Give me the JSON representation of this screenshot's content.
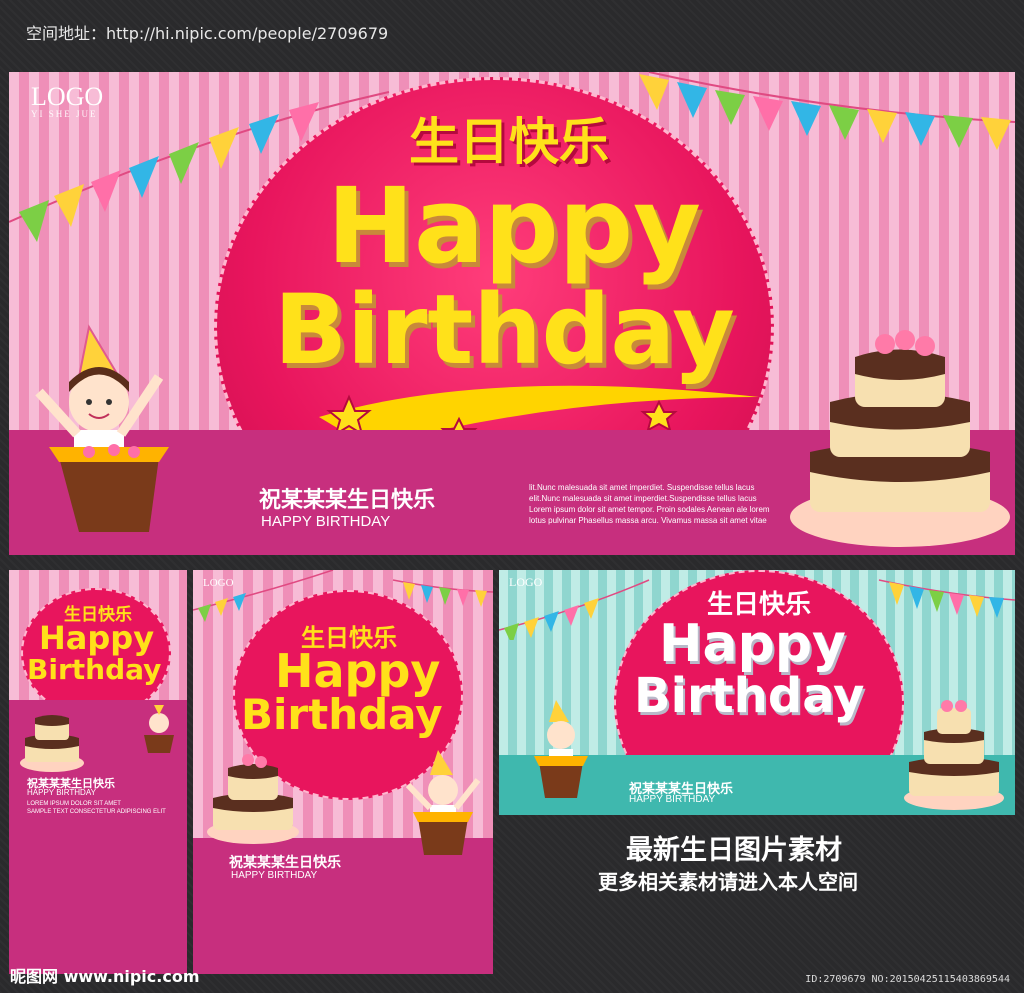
{
  "header": {
    "url_label": "空间地址：",
    "url": "http://hi.nipic.com/people/2709679"
  },
  "main_banner": {
    "logo": "LOGO",
    "logo_sub": "YI SHE JUE",
    "title_cn": "生日快乐",
    "title_en_1": "Happy",
    "title_en_2": "Birthday",
    "caption_cn": "祝某某某生日快乐",
    "caption_en": "HAPPY BIRTHDAY",
    "body_lines": [
      "lit.Nunc malesuada sit amet imperdiet. Suspendisse tellus lacus",
      "elit.Nunc malesuada sit amet imperdiet.Suspendisse tellus lacus",
      "Lorem ipsum dolor sit amet tempor. Proin sodales Aenean ale lorem",
      "lotus pulvinar Phasellus massa arcu. Vivamus massa sit amet vitae"
    ],
    "colors": {
      "primary": "#e8155d",
      "title_yellow": "#ffe11a",
      "band": "#c72f7e"
    }
  },
  "panel_small": {
    "title_cn": "生日快乐",
    "title_en_1": "Happy",
    "title_en_2": "Birthday",
    "caption_cn": "祝某某某生日快乐",
    "caption_en": "HAPPY BIRTHDAY",
    "text_1": "LOREM IPSUM DOLOR SIT AMET",
    "text_2": "SAMPLE TEXT CONSECTETUR ADIPISCING ELIT"
  },
  "panel_mid": {
    "logo": "LOGO",
    "title_cn": "生日快乐",
    "title_en_1": "Happy",
    "title_en_2": "Birthday",
    "caption_cn": "祝某某某生日快乐",
    "caption_en": "HAPPY BIRTHDAY"
  },
  "panel_teal": {
    "logo": "LOGO",
    "title_cn": "生日快乐",
    "title_en_1": "Happy",
    "title_en_2": "Birthday",
    "caption_cn": "祝某某某生日快乐",
    "caption_en": "HAPPY BIRTHDAY"
  },
  "promo": {
    "title": "最新生日图片素材",
    "subtitle": "更多相关素材请进入本人空间"
  },
  "footer": {
    "site": "昵图网 www.nipic.com",
    "id_text": "ID:2709679 NO:20150425115403869544"
  }
}
